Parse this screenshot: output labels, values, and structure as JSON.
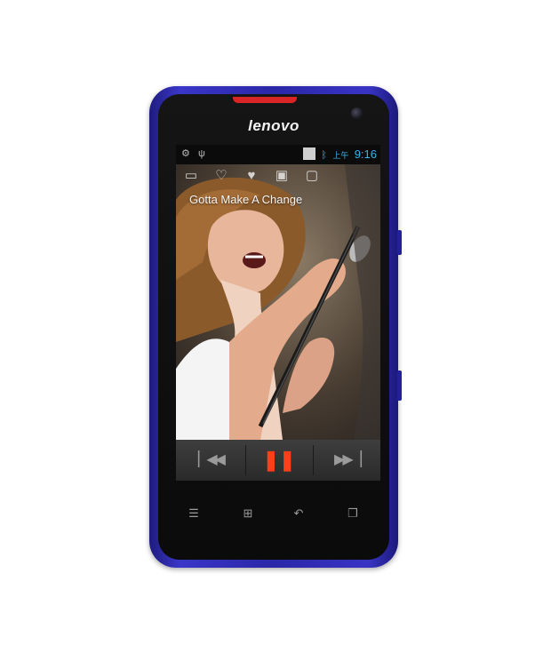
{
  "device": {
    "brand_logo": "lenovo",
    "accent_color": "#d92525",
    "body_color": "#2f2cb8"
  },
  "statusbar": {
    "left_icons": [
      "usb-debug-icon",
      "usb-icon"
    ],
    "ampm": "上午",
    "time": "9:16",
    "right_icons": [
      "album-thumbnail-icon",
      "bluetooth-icon",
      "signal-icon"
    ]
  },
  "player": {
    "action_icons": [
      "playlist-icon",
      "favorite-icon",
      "unfavorite-icon",
      "album-icon",
      "lyrics-icon"
    ],
    "song_title": "Gotta Make A Change",
    "controls": {
      "prev_icon": "skip-previous-icon",
      "play_icon": "pause-icon",
      "next_icon": "skip-next-icon",
      "play_color": "#ff3f1a"
    }
  },
  "softkeys": [
    "menu-icon",
    "home-icon",
    "back-icon",
    "recent-apps-icon"
  ]
}
